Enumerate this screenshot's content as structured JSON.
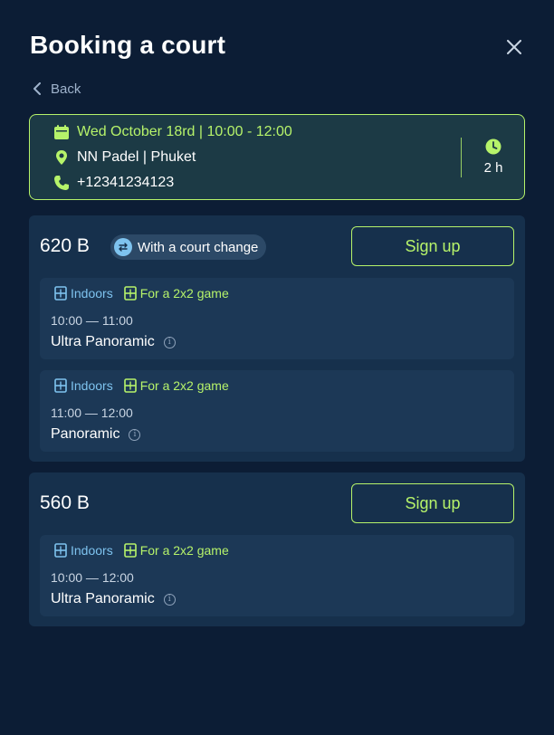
{
  "header": {
    "title": "Booking a court",
    "back_label": "Back"
  },
  "colors": {
    "background": "#0c1d35",
    "accent": "#b6f36a",
    "indoor": "#7ec3ef",
    "card": "#16304c"
  },
  "booking": {
    "date_time": "Wed October 18rd | 10:00 - 12:00",
    "venue": "NN Padel | Phuket",
    "phone": "+12341234123",
    "duration": "2 h"
  },
  "offers": [
    {
      "price": "620 B",
      "badge": "With a court change",
      "signup_label": "Sign up",
      "slots": [
        {
          "tag_indoor": "Indoors",
          "tag_game": "For a 2x2 game",
          "time": "10:00 — 11:00",
          "court": "Ultra Panoramic"
        },
        {
          "tag_indoor": "Indoors",
          "tag_game": "For a 2x2 game",
          "time": "11:00 — 12:00",
          "court": "Panoramic"
        }
      ]
    },
    {
      "price": "560 B",
      "signup_label": "Sign up",
      "slots": [
        {
          "tag_indoor": "Indoors",
          "tag_game": "For a 2x2 game",
          "time": "10:00 — 12:00",
          "court": "Ultra Panoramic"
        }
      ]
    }
  ],
  "icons": {
    "close": "close-icon",
    "back": "chevron-left-icon",
    "calendar": "calendar-icon",
    "location": "location-pin-icon",
    "phone": "phone-icon",
    "clock": "clock-icon",
    "swap": "swap-icon",
    "court": "court-icon",
    "info": "info-icon"
  }
}
